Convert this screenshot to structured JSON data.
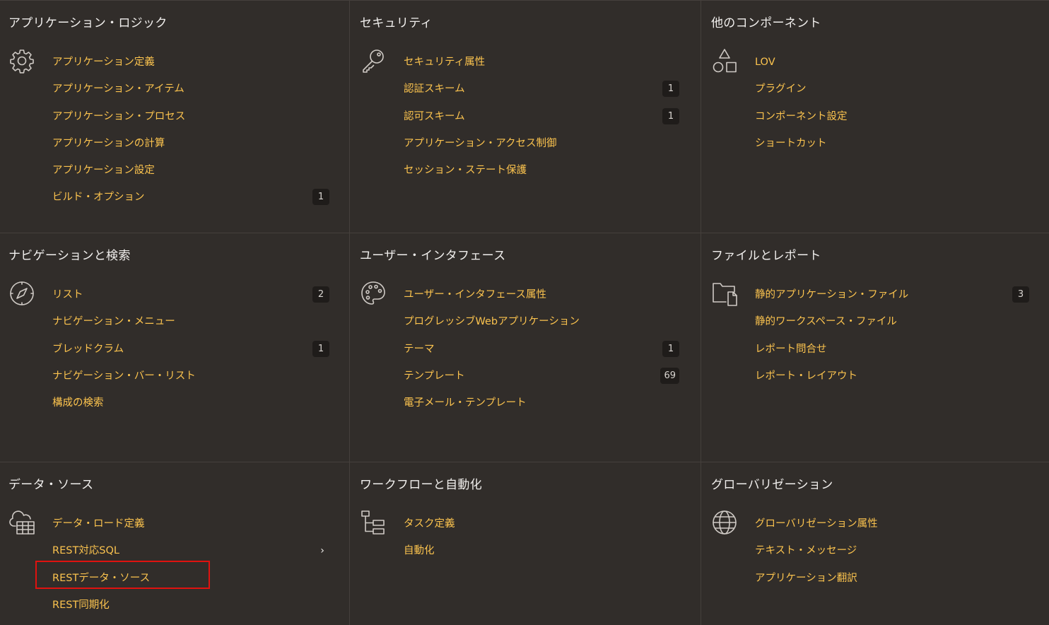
{
  "panels": [
    {
      "title": "アプリケーション・ロジック",
      "icon": "gear-icon",
      "items": [
        {
          "label": "アプリケーション定義"
        },
        {
          "label": "アプリケーション・アイテム"
        },
        {
          "label": "アプリケーション・プロセス"
        },
        {
          "label": "アプリケーションの計算"
        },
        {
          "label": "アプリケーション設定"
        },
        {
          "label": "ビルド・オプション",
          "badge": "1"
        }
      ]
    },
    {
      "title": "セキュリティ",
      "icon": "key-icon",
      "items": [
        {
          "label": "セキュリティ属性"
        },
        {
          "label": "認証スキーム",
          "badge": "1"
        },
        {
          "label": "認可スキーム",
          "badge": "1"
        },
        {
          "label": "アプリケーション・アクセス制御"
        },
        {
          "label": "セッション・ステート保護"
        }
      ]
    },
    {
      "title": "他のコンポーネント",
      "icon": "shapes-icon",
      "items": [
        {
          "label": "LOV"
        },
        {
          "label": "プラグイン"
        },
        {
          "label": "コンポーネント設定"
        },
        {
          "label": "ショートカット"
        }
      ]
    },
    {
      "title": "ナビゲーションと検索",
      "icon": "compass-icon",
      "items": [
        {
          "label": "リスト",
          "badge": "2"
        },
        {
          "label": "ナビゲーション・メニュー"
        },
        {
          "label": "ブレッドクラム",
          "badge": "1"
        },
        {
          "label": "ナビゲーション・バー・リスト"
        },
        {
          "label": "構成の検索"
        }
      ]
    },
    {
      "title": "ユーザー・インタフェース",
      "icon": "palette-icon",
      "items": [
        {
          "label": "ユーザー・インタフェース属性"
        },
        {
          "label": "プログレッシブWebアプリケーション"
        },
        {
          "label": "テーマ",
          "badge": "1"
        },
        {
          "label": "テンプレート",
          "badge": "69"
        },
        {
          "label": "電子メール・テンプレート"
        }
      ]
    },
    {
      "title": "ファイルとレポート",
      "icon": "folder-file-icon",
      "items": [
        {
          "label": "静的アプリケーション・ファイル",
          "badge": "3"
        },
        {
          "label": "静的ワークスペース・ファイル"
        },
        {
          "label": "レポート問合せ"
        },
        {
          "label": "レポート・レイアウト"
        }
      ]
    },
    {
      "title": "データ・ソース",
      "icon": "cloud-grid-icon",
      "items": [
        {
          "label": "データ・ロード定義"
        },
        {
          "label": "REST対応SQL",
          "chevron": "›"
        },
        {
          "label": "RESTデータ・ソース",
          "highlighted": true
        },
        {
          "label": "REST同期化"
        }
      ]
    },
    {
      "title": "ワークフローと自動化",
      "icon": "workflow-icon",
      "items": [
        {
          "label": "タスク定義"
        },
        {
          "label": "自動化"
        }
      ]
    },
    {
      "title": "グローバリゼーション",
      "icon": "globe-icon",
      "items": [
        {
          "label": "グローバリゼーション属性"
        },
        {
          "label": "テキスト・メッセージ"
        },
        {
          "label": "アプリケーション翻訳"
        }
      ]
    }
  ],
  "colors": {
    "background": "#312d2a",
    "link": "#fbc34e",
    "title": "#f1efed",
    "divider": "#45403c",
    "badge_bg": "#1f1c1a",
    "highlight_border": "#e0120f"
  }
}
